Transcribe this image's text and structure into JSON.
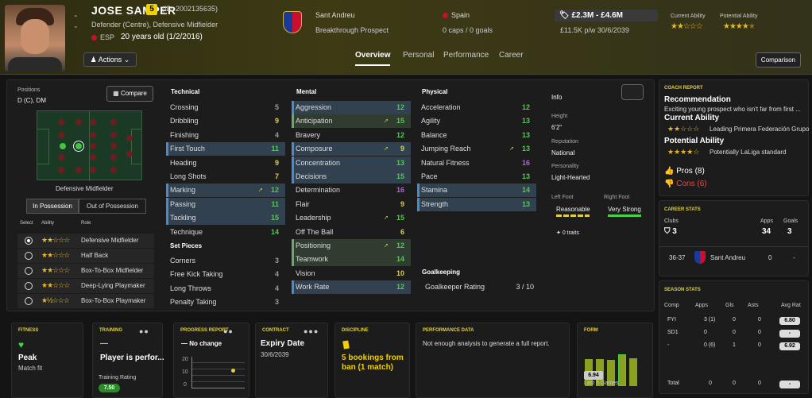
{
  "header": {
    "name": "JOSE SAMPER",
    "squad_number": "5",
    "player_id": "(ID: 2002135635)",
    "positions_title": "Defender (Centre), Defensive Midfielder",
    "nationality": "ESP",
    "age": "20 years old (1/2/2016)",
    "actions_label": "Actions",
    "club": "Sant Andreu",
    "club_status": "Breakthrough Prospect",
    "country": "Spain",
    "caps": "0 caps / 0 goals",
    "value": "£2.3M - £4.6M",
    "wage": "£11.5K p/w 30/6/2039",
    "current_ability_label": "Current Ability",
    "potential_ability_label": "Potential Ability",
    "current_ability_stars": 2,
    "potential_ability_stars": 4.5,
    "tabs": [
      "Overview",
      "Personal",
      "Performance",
      "Career"
    ],
    "active_tab": "Overview",
    "comparison_label": "Comparison"
  },
  "positions": {
    "label": "Positions",
    "value": "D (C), DM",
    "compare_label": "Compare",
    "pitch_role": "Defensive Midfielder",
    "in_possession": "In Possession",
    "out_possession": "Out of Possession",
    "headers": [
      "Select",
      "Ability",
      "Role"
    ],
    "roles": [
      {
        "name": "Defensive Midfielder",
        "stars": "★★☆☆☆",
        "selected": true
      },
      {
        "name": "Half Back",
        "stars": "★★☆☆☆",
        "selected": false
      },
      {
        "name": "Box-To-Box Midfielder",
        "stars": "★★☆☆☆",
        "selected": false
      },
      {
        "name": "Deep-Lying Playmaker",
        "stars": "★★☆☆☆",
        "selected": false
      },
      {
        "name": "Box-To-Box Playmaker",
        "stars": "★½☆☆☆",
        "selected": false
      }
    ]
  },
  "attributes": {
    "technical_label": "Technical",
    "technical": [
      {
        "name": "Crossing",
        "value": "5",
        "c": "gr",
        "hl": ""
      },
      {
        "name": "Dribbling",
        "value": "9",
        "c": "y",
        "hl": ""
      },
      {
        "name": "Finishing",
        "value": "4",
        "c": "gr",
        "hl": ""
      },
      {
        "name": "First Touch",
        "value": "11",
        "c": "g",
        "hl": "hl"
      },
      {
        "name": "Heading",
        "value": "9",
        "c": "y",
        "hl": ""
      },
      {
        "name": "Long Shots",
        "value": "7",
        "c": "y",
        "hl": ""
      },
      {
        "name": "Marking",
        "value": "12",
        "c": "g",
        "hl": "hl",
        "up": true
      },
      {
        "name": "Passing",
        "value": "11",
        "c": "g",
        "hl": "hl"
      },
      {
        "name": "Tackling",
        "value": "15",
        "c": "g",
        "hl": "hl"
      },
      {
        "name": "Technique",
        "value": "14",
        "c": "g",
        "hl": ""
      }
    ],
    "setpieces_label": "Set Pieces",
    "setpieces": [
      {
        "name": "Corners",
        "value": "3",
        "c": "gr"
      },
      {
        "name": "Free Kick Taking",
        "value": "4",
        "c": "gr"
      },
      {
        "name": "Long Throws",
        "value": "4",
        "c": "gr"
      },
      {
        "name": "Penalty Taking",
        "value": "3",
        "c": "gr"
      }
    ],
    "mental_label": "Mental",
    "mental": [
      {
        "name": "Aggression",
        "value": "12",
        "c": "g",
        "hl": "hl"
      },
      {
        "name": "Anticipation",
        "value": "15",
        "c": "g",
        "hl": "hlg",
        "up": true
      },
      {
        "name": "Bravery",
        "value": "12",
        "c": "g",
        "hl": ""
      },
      {
        "name": "Composure",
        "value": "9",
        "c": "y",
        "hl": "hl",
        "up": true
      },
      {
        "name": "Concentration",
        "value": "13",
        "c": "g",
        "hl": "hl"
      },
      {
        "name": "Decisions",
        "value": "15",
        "c": "g",
        "hl": "hl"
      },
      {
        "name": "Determination",
        "value": "16",
        "c": "p",
        "hl": ""
      },
      {
        "name": "Flair",
        "value": "9",
        "c": "y",
        "hl": ""
      },
      {
        "name": "Leadership",
        "value": "15",
        "c": "g",
        "hl": "",
        "up": true
      },
      {
        "name": "Off The Ball",
        "value": "6",
        "c": "y",
        "hl": ""
      },
      {
        "name": "Positioning",
        "value": "12",
        "c": "g",
        "hl": "hlg",
        "up": true
      },
      {
        "name": "Teamwork",
        "value": "14",
        "c": "g",
        "hl": "hlg"
      },
      {
        "name": "Vision",
        "value": "10",
        "c": "y",
        "hl": ""
      },
      {
        "name": "Work Rate",
        "value": "12",
        "c": "g",
        "hl": "hl"
      }
    ],
    "physical_label": "Physical",
    "physical": [
      {
        "name": "Acceleration",
        "value": "12",
        "c": "g",
        "hl": ""
      },
      {
        "name": "Agility",
        "value": "13",
        "c": "g",
        "hl": ""
      },
      {
        "name": "Balance",
        "value": "13",
        "c": "g",
        "hl": ""
      },
      {
        "name": "Jumping Reach",
        "value": "13",
        "c": "g",
        "hl": "",
        "up": true
      },
      {
        "name": "Natural Fitness",
        "value": "16",
        "c": "p",
        "hl": ""
      },
      {
        "name": "Pace",
        "value": "13",
        "c": "g",
        "hl": ""
      },
      {
        "name": "Stamina",
        "value": "14",
        "c": "g",
        "hl": "hl"
      },
      {
        "name": "Strength",
        "value": "13",
        "c": "g",
        "hl": "hl"
      }
    ],
    "goalkeeping_label": "Goalkeeping",
    "gk_rating_label": "Goalkeeper Rating",
    "gk_rating_value": "3 / 10"
  },
  "info": {
    "title": "Info",
    "height_label": "Height",
    "height": "6'2\"",
    "reputation_label": "Reputation",
    "reputation": "National",
    "personality_label": "Personality",
    "personality": "Light-Hearted",
    "left_foot_label": "Left Foot",
    "left_foot": "Reasonable",
    "right_foot_label": "Right Foot",
    "right_foot": "Very Strong",
    "traits": "0 traits"
  },
  "coach_report": {
    "head": "COACH REPORT",
    "rec_title": "Recommendation",
    "rec_text": "Exciting young prospect who isn't far from first ...",
    "ca_title": "Current Ability",
    "ca_text": "Leading Primera Federación Grupo",
    "pa_title": "Potential Ability",
    "pa_text": "Potentially LaLiga standard",
    "pros": "Pros (8)",
    "cons": "Cons (6)"
  },
  "career_stats": {
    "head": "CAREER STATS",
    "clubs_label": "Clubs",
    "apps_label": "Apps",
    "goals_label": "Goals",
    "clubs": "3",
    "apps": "34",
    "goals": "3",
    "row_season": "36-37",
    "row_club": "Sant Andreu",
    "row_apps": "0",
    "row_goals": "-"
  },
  "season_stats": {
    "head": "SEASON STATS",
    "cols": [
      "Comp",
      "Apps",
      "Gls",
      "Asts",
      "Avg Rat"
    ],
    "rows": [
      {
        "comp": "FYI",
        "apps": "3 (1)",
        "gls": "0",
        "asts": "0",
        "rat": "6.80"
      },
      {
        "comp": "SD1",
        "apps": "0",
        "gls": "0",
        "asts": "0",
        "rat": "-"
      },
      {
        "comp": "-",
        "apps": "0 (6)",
        "gls": "1",
        "asts": "0",
        "rat": "6.92"
      }
    ],
    "total_label": "Total",
    "total": {
      "apps": "0",
      "gls": "0",
      "asts": "0",
      "rat": "-"
    }
  },
  "bottom": {
    "fitness_head": "FITNESS",
    "fitness_value": "Peak",
    "fitness_sub": "Match fit",
    "training_head": "TRAINING",
    "training_dash": "—",
    "training_text": "Player is perfor...",
    "training_rating_label": "Training Rating",
    "training_rating": "7.50",
    "progress_head": "PROGRESS REPORT",
    "progress_text": "— No change",
    "progress_ticks": [
      "20",
      "10",
      "0"
    ],
    "contract_head": "CONTRACT",
    "contract_title": "Expiry Date",
    "contract_date": "30/6/2039",
    "discipline_head": "DISCIPLINE",
    "discipline_text": "5 bookings from ban (1 match)",
    "perf_head": "PERFORMANCE DATA",
    "perf_text": "Not enough analysis to generate a full report.",
    "form_head": "FORM",
    "form_rating": "6.94",
    "form_sub": "Last 5 Games",
    "form_levels": [
      0.62,
      0.62,
      0.6,
      0.72,
      0.64
    ]
  }
}
